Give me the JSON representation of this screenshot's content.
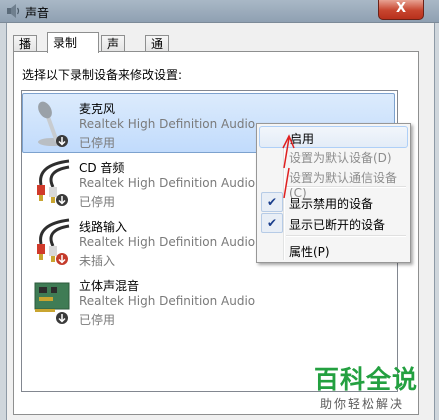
{
  "window": {
    "title": "声音",
    "close_label": "X"
  },
  "tabs": [
    {
      "label": "播放"
    },
    {
      "label": "录制"
    },
    {
      "label": "声音"
    },
    {
      "label": "通信"
    }
  ],
  "instruction": "选择以下录制设备来修改设置:",
  "devices": [
    {
      "name": "麦克风",
      "driver": "Realtek High Definition Audio",
      "status": "已停用",
      "icon": "microphone-icon"
    },
    {
      "name": "CD 音频",
      "driver": "Realtek High Definition Audio",
      "status": "已停用",
      "icon": "audio-cable-icon"
    },
    {
      "name": "线路输入",
      "driver": "Realtek High Definition Audio",
      "status": "未插入",
      "icon": "audio-cable-icon"
    },
    {
      "name": "立体声混音",
      "driver": "Realtek High Definition Audio",
      "status": "已停用",
      "icon": "circuit-board-icon"
    }
  ],
  "context_menu": {
    "items": [
      {
        "label": "启用",
        "disabled": false
      },
      {
        "label": "设置为默认设备(D)",
        "disabled": true
      },
      {
        "label": "设置为默认通信设备(C)",
        "disabled": true
      },
      {
        "label": "显示禁用的设备",
        "checked": true
      },
      {
        "label": "显示已断开的设备",
        "checked": true
      },
      {
        "label": "属性(P)",
        "disabled": false
      }
    ]
  },
  "watermark": {
    "title": "百科全说",
    "subtitle": "助你轻松解决"
  },
  "colors": {
    "annotation": "#e02020",
    "selection": "#c1dbfc",
    "watermark": "#23a040"
  }
}
